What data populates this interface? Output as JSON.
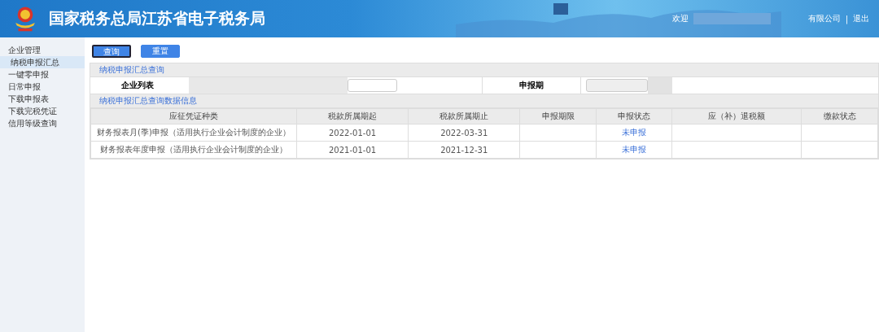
{
  "header": {
    "title": "国家税务总局江苏省电子税务局",
    "welcome": "欢迎",
    "company": "有限公司",
    "separator": "|",
    "logout": "退出"
  },
  "sidebar": {
    "items": [
      {
        "label": "企业管理",
        "selected": false
      },
      {
        "label": "纳税申报汇总",
        "selected": true
      },
      {
        "label": "一键零申报",
        "selected": false
      },
      {
        "label": "日常申报",
        "selected": false
      },
      {
        "label": "下载申报表",
        "selected": false
      },
      {
        "label": "下载完税凭证",
        "selected": false
      },
      {
        "label": "信用等级查询",
        "selected": false
      }
    ]
  },
  "buttons": [
    {
      "label": "查询",
      "selected": true
    },
    {
      "label": "重置",
      "selected": false
    }
  ],
  "query_section": {
    "title": "纳税申报汇总查询",
    "fields": [
      {
        "label": "企业列表"
      },
      {
        "label": "申报期"
      }
    ]
  },
  "table": {
    "title": "纳税申报汇总查询数据信息",
    "columns": [
      "应征凭证种类",
      "税款所属期起",
      "税款所属期止",
      "申报期限",
      "申报状态",
      "应（补）退税额",
      "缴款状态"
    ],
    "rows": [
      [
        "财务报表月(季)申报（适用执行企业会计制度的企业）",
        "2022-01-01",
        "2022-03-31",
        "",
        "未申报",
        "",
        ""
      ],
      [
        "财务报表年度申报（适用执行企业会计制度的企业）",
        "2021-01-01",
        "2021-12-31",
        "",
        "未申报",
        "",
        ""
      ]
    ]
  }
}
